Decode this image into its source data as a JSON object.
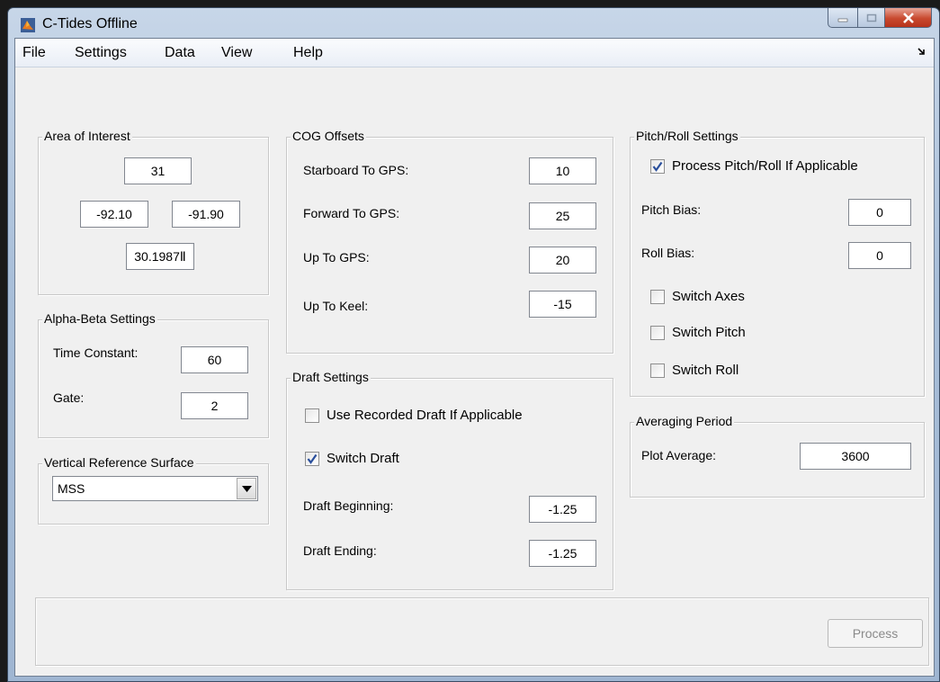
{
  "window": {
    "title": "C-Tides Offline"
  },
  "menu": [
    "File",
    "Settings",
    "Data",
    "View",
    "Help"
  ],
  "area_of_interest": {
    "title": "Area of Interest",
    "top": "31",
    "west": "-92.10",
    "east": "-91.90",
    "bottom": "30.1987Ⅱ"
  },
  "alpha_beta": {
    "title": "Alpha-Beta Settings",
    "time_constant_label": "Time Constant:",
    "time_constant": "60",
    "gate_label": "Gate:",
    "gate": "2"
  },
  "vrs": {
    "title": "Vertical Reference Surface",
    "selected": "MSS"
  },
  "cog": {
    "title": "COG Offsets",
    "rows": [
      {
        "label": "Starboard To GPS:",
        "value": "10"
      },
      {
        "label": "Forward To GPS:",
        "value": "25"
      },
      {
        "label": "Up To GPS:",
        "value": "20"
      },
      {
        "label": "Up To Keel:",
        "value": "-15"
      }
    ]
  },
  "draft": {
    "title": "Draft Settings",
    "use_recorded_label": "Use Recorded Draft If Applicable",
    "use_recorded_checked": false,
    "switch_draft_label": "Switch Draft",
    "switch_draft_checked": true,
    "beginning_label": "Draft Beginning:",
    "beginning": "-1.25",
    "ending_label": "Draft Ending:",
    "ending": "-1.25"
  },
  "pitch_roll": {
    "title": "Pitch/Roll Settings",
    "process_label": "Process Pitch/Roll If Applicable",
    "process_checked": true,
    "pitch_bias_label": "Pitch Bias:",
    "pitch_bias": "0",
    "roll_bias_label": "Roll Bias:",
    "roll_bias": "0",
    "switch_axes_label": "Switch Axes",
    "switch_pitch_label": "Switch Pitch",
    "switch_roll_label": "Switch Roll"
  },
  "averaging": {
    "title": "Averaging Period",
    "plot_average_label": "Plot Average:",
    "plot_average": "3600"
  },
  "process_button": "Process",
  "colors": {
    "client_bg": "#f0f0f0",
    "close_button": "#c8492f",
    "check_mark": "#2a4f9c"
  }
}
